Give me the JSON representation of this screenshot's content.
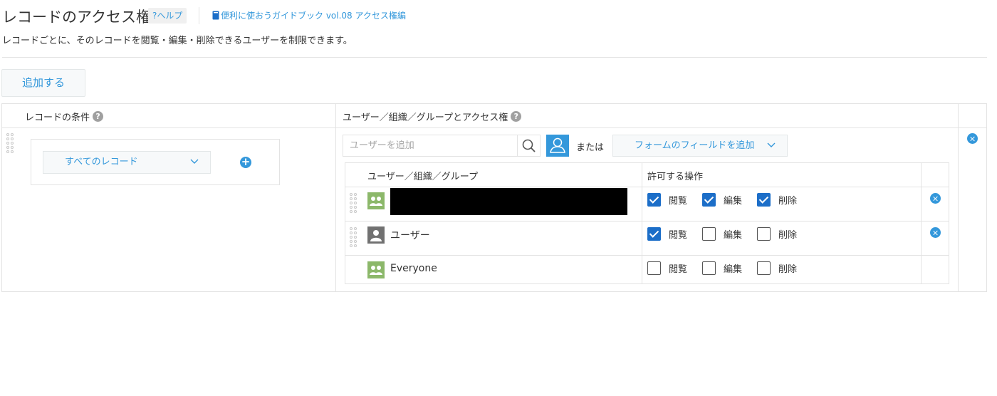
{
  "header": {
    "title": "レコードのアクセス権",
    "help_label": "?ヘルプ",
    "guide_label": "便利に使おうガイドブック vol.08 アクセス権編",
    "description": "レコードごとに、そのレコードを閲覧・編集・削除できるユーザーを制限できます。"
  },
  "toolbar": {
    "add_label": "追加する"
  },
  "table": {
    "col_condition": "レコードの条件",
    "col_users": "ユーザー／組織／グループとアクセス権"
  },
  "condition": {
    "selected": "すべてのレコード"
  },
  "user_picker": {
    "placeholder": "ユーザーを追加",
    "or_text": "または",
    "field_button_label": "フォームのフィールドを追加"
  },
  "inner_table": {
    "col_entity": "ユーザー／組織／グループ",
    "col_permissions": "許可する操作",
    "permission_labels": {
      "view": "閲覧",
      "edit": "編集",
      "delete": "削除"
    },
    "rows": [
      {
        "icon": "group-icon",
        "name": "",
        "redacted": true,
        "view": true,
        "edit": true,
        "delete": true
      },
      {
        "icon": "user-icon",
        "name": "ユーザー",
        "redacted": false,
        "view": true,
        "edit": false,
        "delete": false
      },
      {
        "icon": "group-icon",
        "name": "Everyone",
        "redacted": false,
        "view": false,
        "edit": false,
        "delete": false
      }
    ]
  },
  "colors": {
    "accent": "#3498db",
    "checkbox_on": "#1c6ec8",
    "group_icon": "#8cb86a",
    "user_icon": "#717171"
  }
}
